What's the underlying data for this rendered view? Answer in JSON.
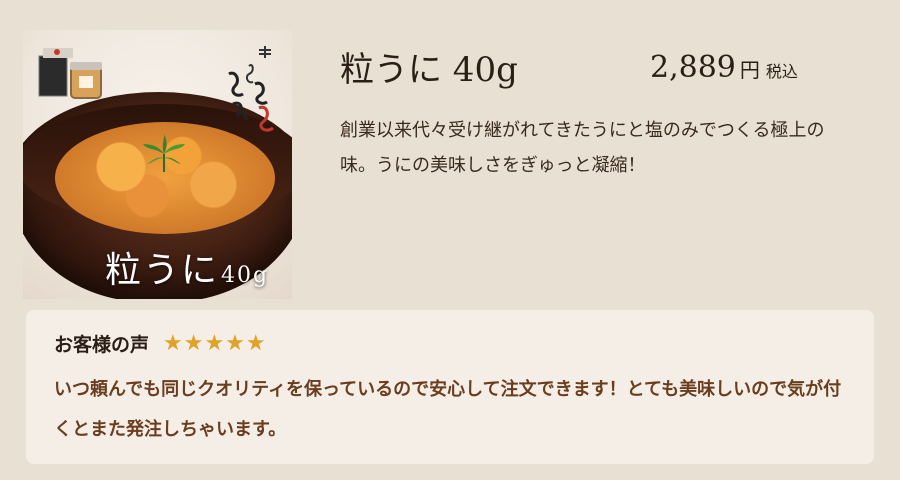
{
  "product": {
    "title": "粒うに 40g",
    "price": "2,889",
    "price_unit": "円",
    "tax_label": "税込",
    "description": "創業以来代々受け継がれてきたうにと塩のみでつくる極上の味。うにの美味しさをぎゅっと凝縮！",
    "image": {
      "caption_name": "粒うに",
      "caption_weight": "40g"
    }
  },
  "review": {
    "heading": "お客様の声",
    "stars": "★★★★★",
    "rating": 5,
    "text": "いつ頼んでも同じクオリティを保っているので安心して注文できます！とても美味しいので気が付くとまた発注しちゃいます。"
  },
  "colors": {
    "background": "#e8e0d3",
    "card": "#f5eee6",
    "star": "#e0a32a",
    "review_text": "#6a3d1f"
  }
}
